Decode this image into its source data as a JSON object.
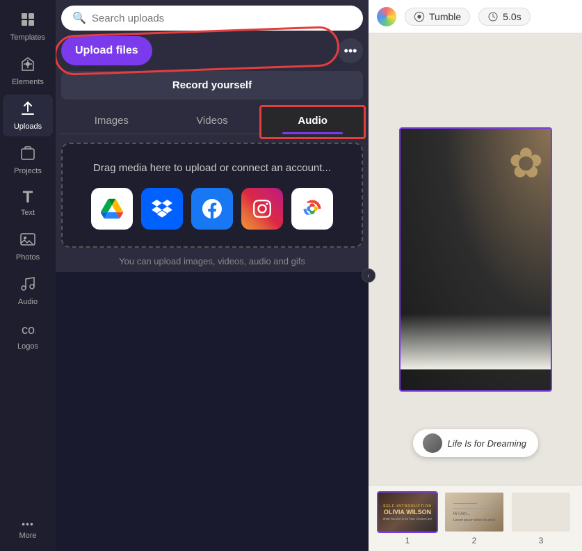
{
  "sidebar": {
    "items": [
      {
        "id": "templates",
        "label": "Templates",
        "icon": "⊞",
        "active": false
      },
      {
        "id": "elements",
        "label": "Elements",
        "icon": "✦",
        "active": false
      },
      {
        "id": "uploads",
        "label": "Uploads",
        "icon": "↑",
        "active": true
      },
      {
        "id": "projects",
        "label": "Projects",
        "icon": "▢",
        "active": false
      },
      {
        "id": "text",
        "label": "Text",
        "icon": "T",
        "active": false
      },
      {
        "id": "photos",
        "label": "Photos",
        "icon": "🖼",
        "active": false
      },
      {
        "id": "audio",
        "label": "Audio",
        "icon": "♪",
        "active": false
      },
      {
        "id": "logos",
        "label": "Logos",
        "icon": "⬡",
        "active": false
      },
      {
        "id": "more",
        "label": "More",
        "icon": "•••",
        "active": false
      }
    ]
  },
  "upload_panel": {
    "search_placeholder": "Search uploads",
    "upload_btn_label": "Upload files",
    "more_btn_label": "•••",
    "record_btn_label": "Record yourself",
    "tabs": [
      {
        "id": "images",
        "label": "Images",
        "active": false
      },
      {
        "id": "videos",
        "label": "Videos",
        "active": false
      },
      {
        "id": "audio",
        "label": "Audio",
        "active": true
      }
    ],
    "drop_area": {
      "text": "Drag media here to upload or connect an account...",
      "services": [
        {
          "id": "gdrive",
          "label": "Google Drive"
        },
        {
          "id": "dropbox",
          "label": "Dropbox"
        },
        {
          "id": "facebook",
          "label": "Facebook"
        },
        {
          "id": "instagram",
          "label": "Instagram"
        },
        {
          "id": "gphotos",
          "label": "Google Photos"
        }
      ]
    },
    "hint": "You can upload images, videos, audio and gifs"
  },
  "canvas": {
    "topbar": {
      "tumble_label": "Tumble",
      "timer_label": "5.0s"
    },
    "music": {
      "title": "Life Is for Dreaming"
    },
    "filmstrip": {
      "slides": [
        {
          "num": "1",
          "selected": true
        },
        {
          "num": "2",
          "selected": false
        },
        {
          "num": "3",
          "selected": false
        }
      ]
    }
  }
}
